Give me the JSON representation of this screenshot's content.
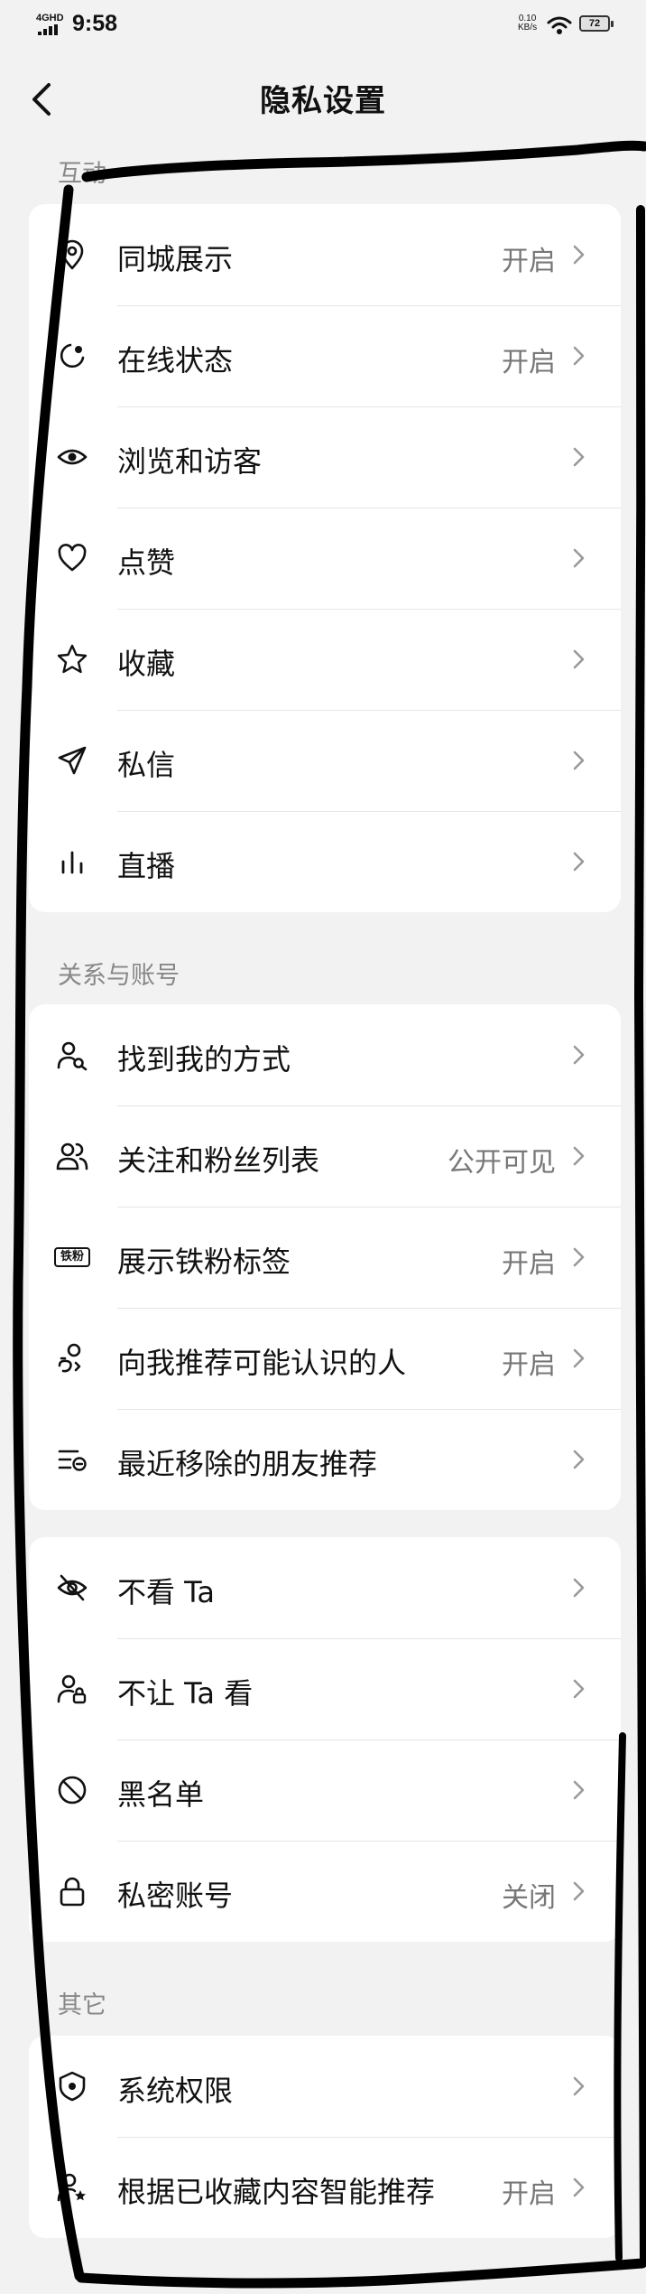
{
  "status_bar": {
    "network": "4GHD",
    "time": "9:58",
    "speed_value": "0.10",
    "speed_unit": "KB/s",
    "battery": "72"
  },
  "header": {
    "title": "隐私设置"
  },
  "sections": {
    "interaction": {
      "title": "互动",
      "items": [
        {
          "label": "同城展示",
          "value": "开启",
          "icon": "location-pin-icon"
        },
        {
          "label": "在线状态",
          "value": "开启",
          "icon": "online-status-icon"
        },
        {
          "label": "浏览和访客",
          "value": "",
          "icon": "eye-icon"
        },
        {
          "label": "点赞",
          "value": "",
          "icon": "heart-icon"
        },
        {
          "label": "收藏",
          "value": "",
          "icon": "star-icon"
        },
        {
          "label": "私信",
          "value": "",
          "icon": "paper-plane-icon"
        },
        {
          "label": "直播",
          "value": "",
          "icon": "bar-chart-icon"
        }
      ]
    },
    "relations": {
      "title": "关系与账号",
      "items": [
        {
          "label": "找到我的方式",
          "value": "",
          "icon": "user-search-icon"
        },
        {
          "label": "关注和粉丝列表",
          "value": "公开可见",
          "icon": "users-icon"
        },
        {
          "label": "展示铁粉标签",
          "value": "开启",
          "icon": "iron-fan-badge-icon",
          "badge_text": "铁粉"
        },
        {
          "label": "向我推荐可能认识的人",
          "value": "开启",
          "icon": "user-recommend-icon"
        },
        {
          "label": "最近移除的朋友推荐",
          "value": "",
          "icon": "list-remove-icon"
        }
      ]
    },
    "blocking": {
      "items": [
        {
          "label": "不看 Ta",
          "value": "",
          "icon": "eye-off-icon"
        },
        {
          "label": "不让 Ta 看",
          "value": "",
          "icon": "user-lock-icon"
        },
        {
          "label": "黑名单",
          "value": "",
          "icon": "block-icon"
        },
        {
          "label": "私密账号",
          "value": "关闭",
          "icon": "lock-icon"
        }
      ]
    },
    "other": {
      "title": "其它",
      "items": [
        {
          "label": "系统权限",
          "value": "",
          "icon": "shield-icon"
        },
        {
          "label": "根据已收藏内容智能推荐",
          "value": "开启",
          "icon": "user-star-icon"
        }
      ]
    }
  },
  "colors": {
    "background": "#f2f2f2",
    "card": "#ffffff",
    "text": "#111111",
    "secondary_text": "#777777",
    "scribble": "#000000"
  }
}
